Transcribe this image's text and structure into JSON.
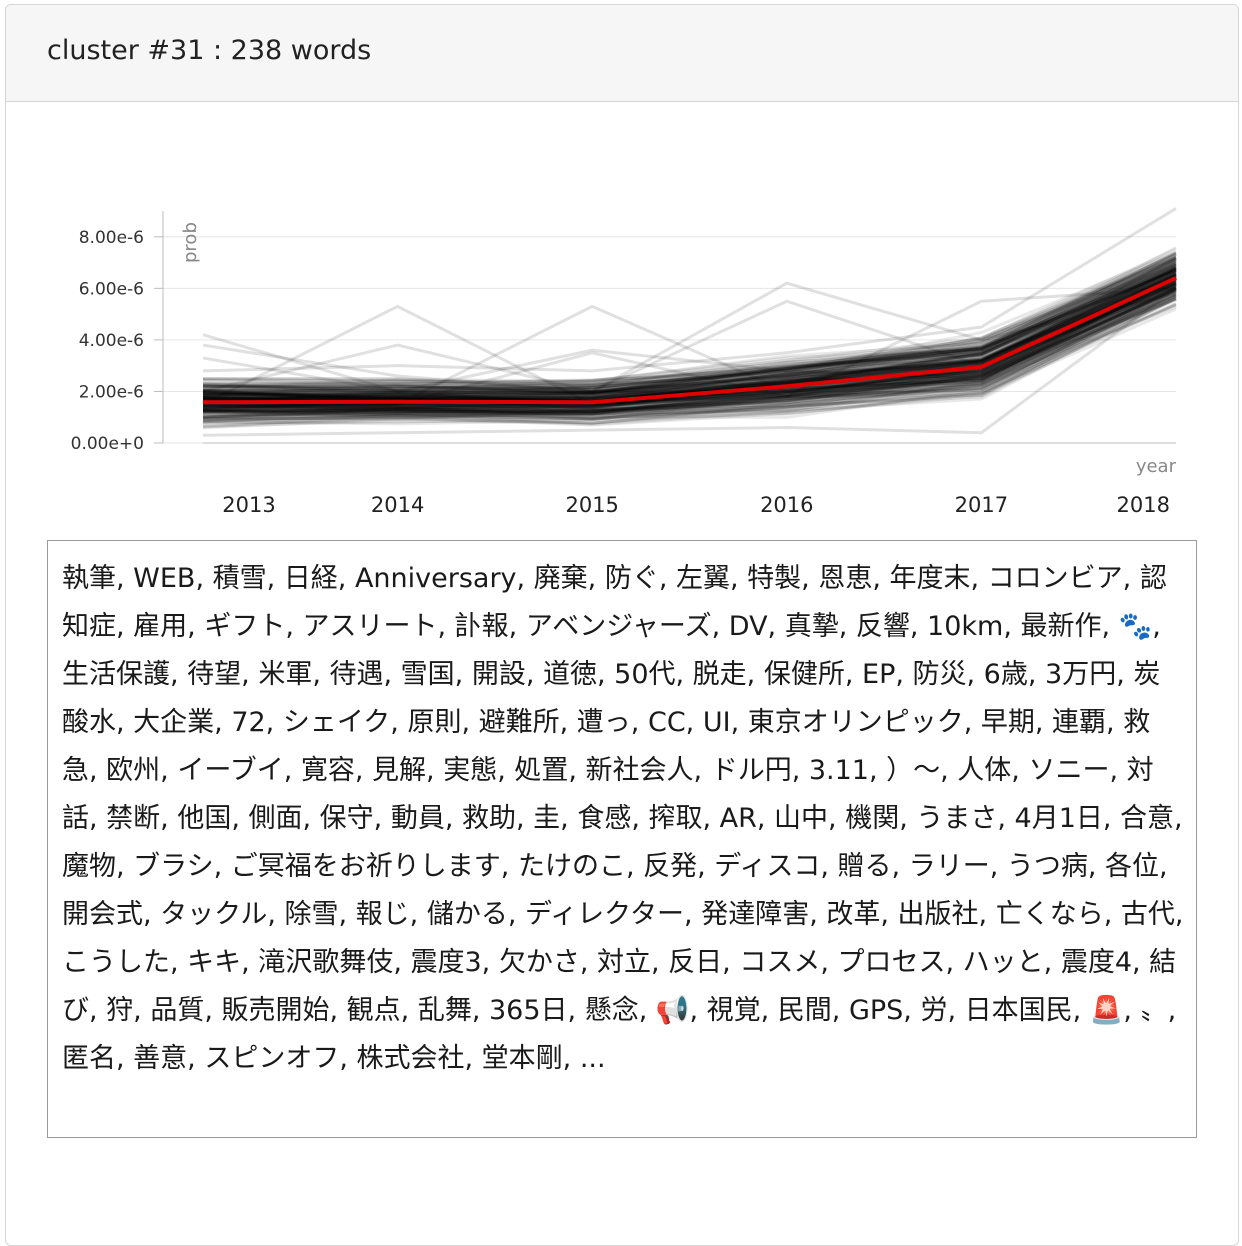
{
  "card": {
    "title": "cluster #31 : 238 words"
  },
  "chart_data": {
    "type": "line",
    "x": [
      "2013",
      "2014",
      "2015",
      "2016",
      "2017",
      "2018"
    ],
    "xlabel": "year",
    "ylabel": "prob",
    "yticks": [
      "0.00e+0",
      "2.00e-6",
      "4.00e-6",
      "6.00e-6",
      "8.00e-6"
    ],
    "ylim": [
      0,
      9e-06
    ],
    "grid": true,
    "mean_series": {
      "color": "#e00000",
      "values": [
        1.58e-06,
        1.6e-06,
        1.58e-06,
        2.2e-06,
        2.95e-06,
        6.4e-06
      ]
    },
    "member_series_color": "#000000",
    "member_series_count": 238,
    "highlighted_series": [
      [
        4.2e-06,
        2e-06,
        1.5e-06,
        2e-06,
        2.5e-06,
        6e-06
      ],
      [
        3.8e-06,
        2.6e-06,
        2e-06,
        1.8e-06,
        3e-06,
        6.4e-06
      ],
      [
        1.5e-06,
        5.3e-06,
        1.5e-06,
        2e-06,
        2.5e-06,
        6e-06
      ],
      [
        1.5e-06,
        1.5e-06,
        5.3e-06,
        2e-06,
        2.5e-06,
        6e-06
      ],
      [
        1.5e-06,
        1.5e-06,
        2e-06,
        6.2e-06,
        4e-06,
        5.8e-06
      ],
      [
        2e-06,
        3.8e-06,
        2e-06,
        2e-06,
        2.8e-06,
        6.2e-06
      ],
      [
        1e-06,
        1.5e-06,
        3.5e-06,
        1.8e-06,
        5.5e-06,
        6e-06
      ],
      [
        2.5e-06,
        2.5e-06,
        2e-06,
        5.5e-06,
        3e-06,
        7.2e-06
      ],
      [
        3.3e-06,
        2e-06,
        3.6e-06,
        2.8e-06,
        2.5e-06,
        5.6e-06
      ],
      [
        3e-07,
        4e-07,
        5e-07,
        6e-07,
        4e-07,
        6e-06
      ],
      [
        2.8e-06,
        3e-06,
        2.8e-06,
        3.5e-06,
        4.5e-06,
        9.1e-06
      ]
    ]
  },
  "words": {
    "text": "執筆, WEB, 積雪, 日経, Anniversary, 廃棄, 防ぐ, 左翼, 特製, 恩恵, 年度末, コロンビア, 認知症, 雇用, ギフト, アスリート, 訃報, アベンジャーズ, DV, 真摯, 反響, 10km, 最新作, 🐾, 生活保護, 待望, 米軍, 待遇, 雪国, 開設, 道徳, 50代, 脱走, 保健所, EP, 防災, 6歳, 3万円, 炭酸水, 大企業, 72, シェイク, 原則, 避難所, 遭っ, CC, UI, 東京オリンピック, 早期, 連覇, 救急, 欧州, イーブイ, 寛容, 見解, 実態, 処置, 新社会人, ドル円, 3.11, ）〜, 人体, ソニー, 対話, 禁断, 他国, 側面, 保守, 動員, 救助, 圭, 食感, 搾取, AR, 山中, 機関, うまさ, 4月1日, 合意, 魔物, ブラシ, ご冥福をお祈りします, たけのこ, 反発, ディスコ, 贈る, ラリー, うつ病, 各位, 開会式, タックル, 除雪, 報じ, 儲かる, ディレクター, 発達障害, 改革, 出版社, 亡くなら, 古代, こうした, キキ, 滝沢歌舞伎, 震度3, 欠かさ, 対立, 反日, コスメ, プロセス, ハッと, 震度4, 結び, 狩, 品質, 販売開始, 観点, 乱舞, 365日, 懸念, 📢, 視覚, 民間, GPS, 労, 日本国民, 🚨, 〟, 匿名, 善意, スピンオフ, 株式会社, 堂本剛, ..."
  }
}
